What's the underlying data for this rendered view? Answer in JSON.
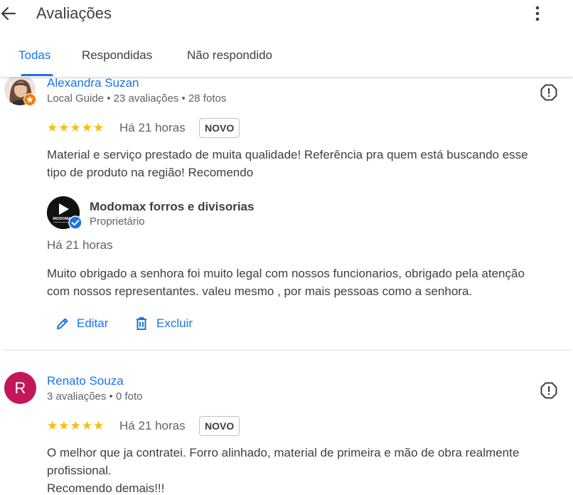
{
  "header": {
    "title": "Avaliações",
    "back_icon": "arrow-back-icon",
    "more_icon": "more-vert-icon"
  },
  "tabs": [
    {
      "label": "Todas",
      "active": true
    },
    {
      "label": "Respondidas",
      "active": false
    },
    {
      "label": "Não respondido",
      "active": false
    }
  ],
  "colors": {
    "accent": "#1a73e8",
    "star": "#fbbc04",
    "text": "#3c4043",
    "muted": "#5f6368",
    "avatar_r": "#c2185b",
    "local_guide_badge": "#f57c00"
  },
  "reviews": [
    {
      "author": "Alexandra Suzan",
      "meta": "Local Guide • 23 avaliações • 28 fotos",
      "stars": "★★★★★",
      "rating": 5,
      "time": "Há 21 horas",
      "badge": "NOVO",
      "text_line1": "Material e serviço prestado de muita qualidade! Referência pra quem está buscando esse",
      "text_line2": "tipo de produto na região! Recomendo",
      "reply": {
        "owner_name": "Modomax forros e divisorias",
        "owner_role": "Proprietário",
        "logo_text": "MODOMAX",
        "time": "Há 21 horas",
        "text_line1": "Muito obrigado a senhora foi muito legal com nossos funcionarios, obrigado pela atenção",
        "text_line2": "com nossos representantes. valeu mesmo , por mais pessoas como a senhora."
      },
      "actions": {
        "edit": "Editar",
        "delete": "Excluir"
      }
    },
    {
      "author": "Renato Souza",
      "avatar_letter": "R",
      "meta": "3 avaliações • 0 foto",
      "stars": "★★★★★",
      "rating": 5,
      "time": "Há 21 horas",
      "badge": "NOVO",
      "text_line1": "O melhor que ja contratei. Forro alinhado, material de primeira e mão de obra realmente",
      "text_line2": "profissional.",
      "text_line3": "Recomendo demais!!!"
    }
  ]
}
